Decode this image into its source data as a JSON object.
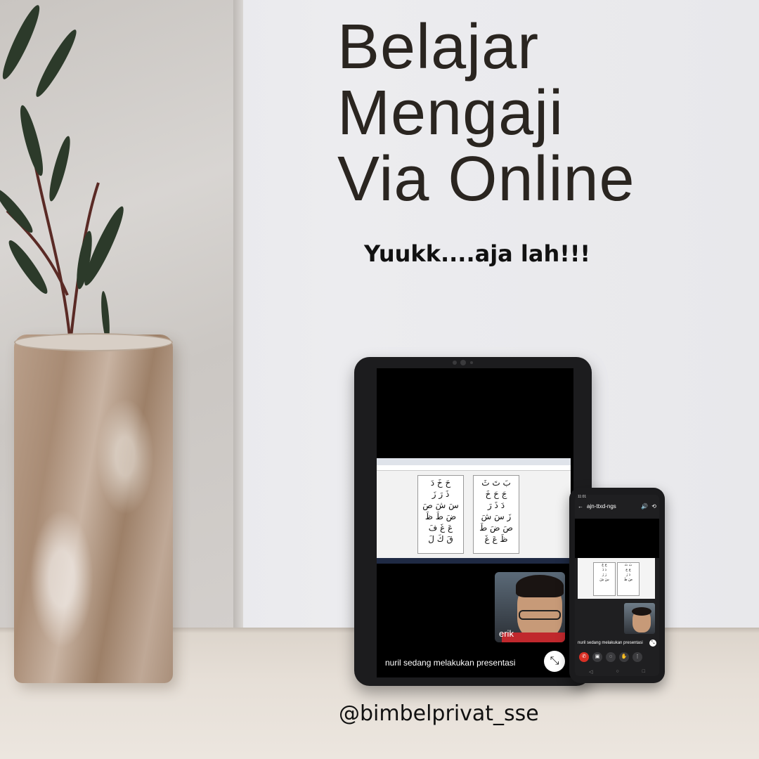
{
  "headline": {
    "line1": "Belajar",
    "line2": "Mengaji",
    "line3": "Via Online"
  },
  "subheadline": "Yuukk....aja lah!!!",
  "handle": "@bimbelprivat_sse",
  "tablet": {
    "participant_name": "erik",
    "presenting_text": "nuril sedang melakukan presentasi",
    "minimize_icon": "minimize-icon"
  },
  "phone": {
    "status_time": "11:01",
    "meeting_code": "ajn-ttxd-ngs",
    "presenting_text": "nuril sedang melakukan presentasi",
    "controls": [
      "end-call-icon",
      "camera-icon",
      "mic-off-icon",
      "hand-raise-icon",
      "more-icon"
    ]
  },
  "colors": {
    "headline": "#2a2520",
    "end_call": "#d93025",
    "device_body": "#1c1c1e"
  }
}
